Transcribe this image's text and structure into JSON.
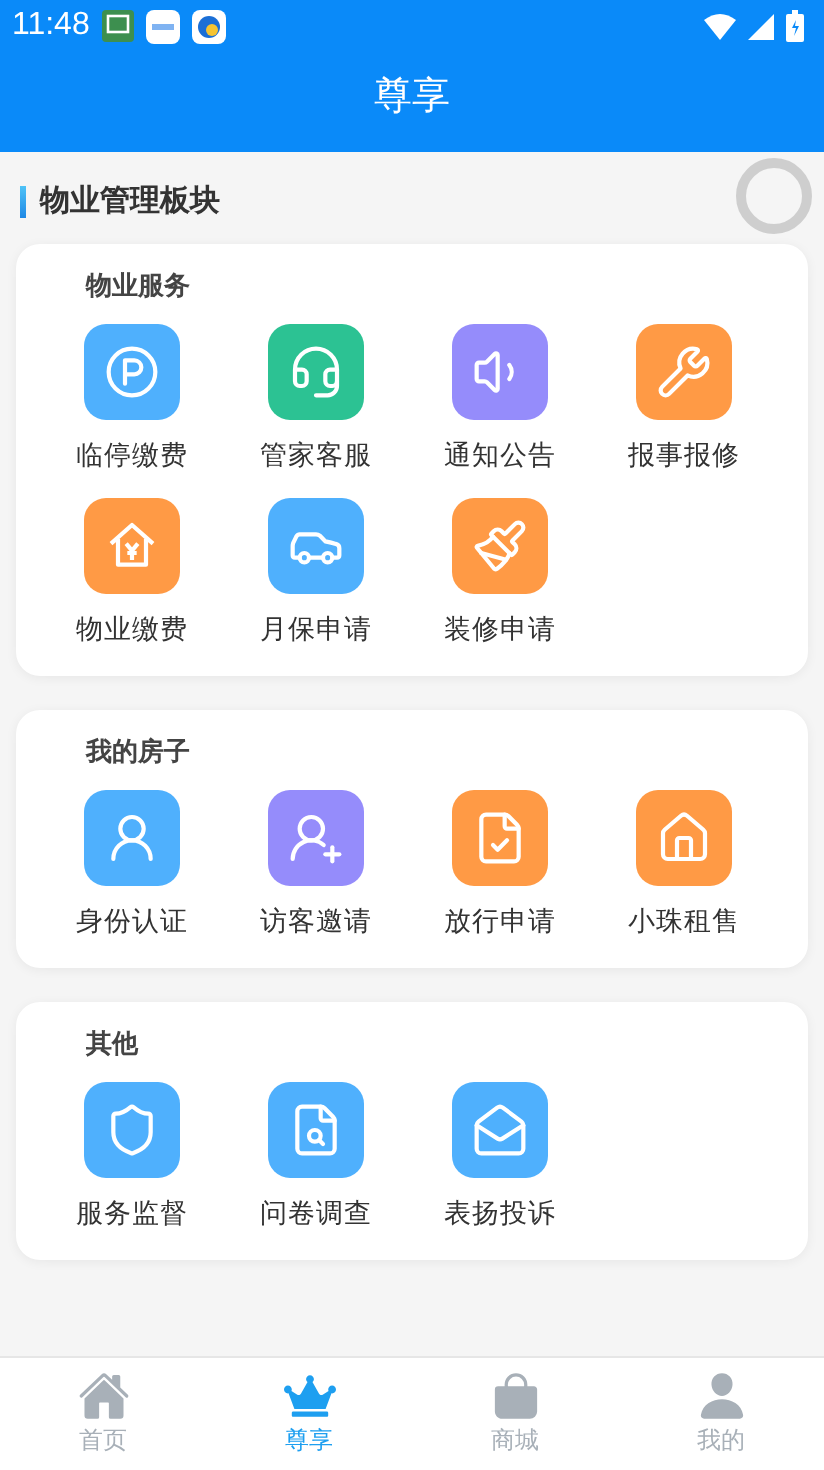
{
  "status_bar": {
    "time": "11:48"
  },
  "header": {
    "title": "尊享"
  },
  "section": {
    "title": "物业管理板块"
  },
  "cards": [
    {
      "title": "物业服务",
      "items": [
        {
          "label": "临停缴费",
          "kind": "parking",
          "color": "#4fb0fd"
        },
        {
          "label": "管家客服",
          "kind": "headset",
          "color": "#2cc293"
        },
        {
          "label": "通知公告",
          "kind": "speaker",
          "color": "#958cfb"
        },
        {
          "label": "报事报修",
          "kind": "wrench",
          "color": "#ff9a45"
        },
        {
          "label": "物业缴费",
          "kind": "housefee",
          "color": "#ff9a45"
        },
        {
          "label": "月保申请",
          "kind": "car",
          "color": "#4fb0fd"
        },
        {
          "label": "装修申请",
          "kind": "brush",
          "color": "#ff9a45"
        }
      ]
    },
    {
      "title": "我的房子",
      "items": [
        {
          "label": "身份认证",
          "kind": "user",
          "color": "#4fb0fd"
        },
        {
          "label": "访客邀请",
          "kind": "useradd",
          "color": "#958cfb"
        },
        {
          "label": "放行申请",
          "kind": "filecheck",
          "color": "#ff9a45"
        },
        {
          "label": "小珠租售",
          "kind": "house",
          "color": "#ff9a45"
        }
      ]
    },
    {
      "title": "其他",
      "items": [
        {
          "label": "服务监督",
          "kind": "shield",
          "color": "#4fb0fd"
        },
        {
          "label": "问卷调查",
          "kind": "survey",
          "color": "#4fb0fd"
        },
        {
          "label": "表扬投诉",
          "kind": "mail",
          "color": "#4fb0fd"
        }
      ]
    }
  ],
  "tabs": [
    {
      "label": "首页",
      "kind": "home",
      "selected": false
    },
    {
      "label": "尊享",
      "kind": "crown",
      "selected": true
    },
    {
      "label": "商城",
      "kind": "bag",
      "selected": false
    },
    {
      "label": "我的",
      "kind": "person",
      "selected": false
    }
  ]
}
